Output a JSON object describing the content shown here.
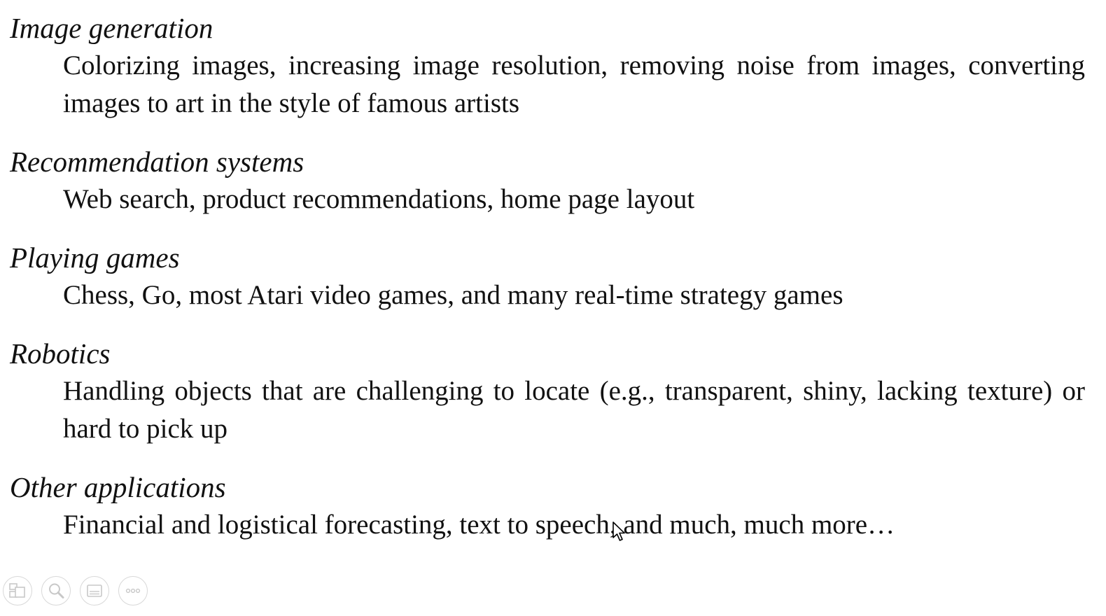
{
  "sections": [
    {
      "heading": "Image generation",
      "body": "Colorizing images, increasing image resolution, removing noise from images, converting images to art in the style of famous artists"
    },
    {
      "heading": "Recommendation systems",
      "body": "Web search, product recommendations, home page layout"
    },
    {
      "heading": "Playing games",
      "body": "Chess, Go, most Atari video games, and many real-time strategy games"
    },
    {
      "heading": "Robotics",
      "body": "Handling objects that are challenging to locate (e.g., transparent, shiny, lacking texture) or hard to pick up"
    },
    {
      "heading": "Other applications",
      "body": "Financial and logistical forecasting, text to speech, and much, much more…"
    }
  ],
  "toolbar": {
    "buttons": [
      {
        "icon": "slides-icon"
      },
      {
        "icon": "zoom-icon"
      },
      {
        "icon": "subtitles-icon"
      },
      {
        "icon": "more-options-icon"
      }
    ],
    "icon_color": "#c8c8c8"
  }
}
